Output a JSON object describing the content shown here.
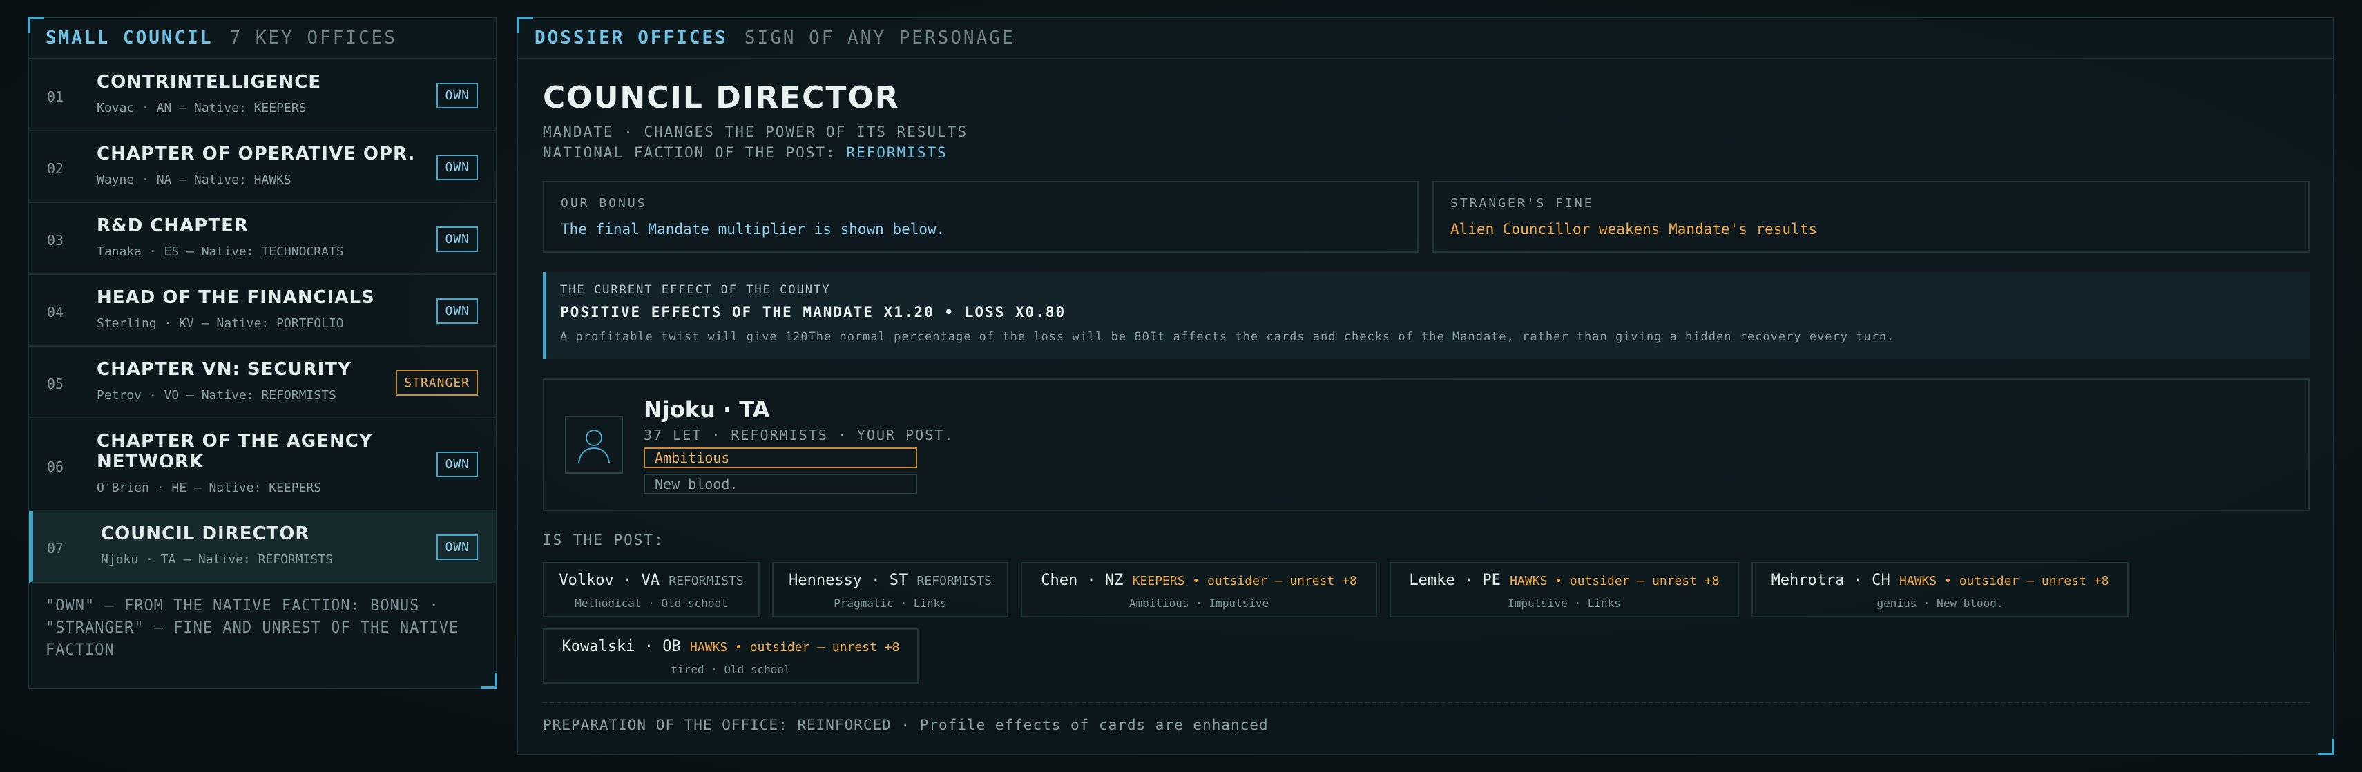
{
  "left_panel": {
    "header_title": "SMALL COUNCIL",
    "header_sub": "7 KEY OFFICES",
    "items": [
      {
        "num": "01",
        "title": "CONTRINTELLIGENCE",
        "sub": "Kovac · AN — Native: KEEPERS",
        "badge": "OWN"
      },
      {
        "num": "02",
        "title": "CHAPTER OF OPERATIVE OPR.",
        "sub": "Wayne · NA — Native: HAWKS",
        "badge": "OWN"
      },
      {
        "num": "03",
        "title": "R&D CHAPTER",
        "sub": "Tanaka · ES — Native: TECHNOCRATS",
        "badge": "OWN"
      },
      {
        "num": "04",
        "title": "HEAD OF THE FINANCIALS",
        "sub": "Sterling · KV — Native: PORTFOLIO",
        "badge": "OWN"
      },
      {
        "num": "05",
        "title": "CHAPTER VN: SECURITY",
        "sub": "Petrov · VO — Native: REFORMISTS",
        "badge": "STRANGER"
      },
      {
        "num": "06",
        "title": "CHAPTER OF THE AGENCY NETWORK",
        "sub": "O'Brien · HE — Native: KEEPERS",
        "badge": "OWN"
      },
      {
        "num": "07",
        "title": "COUNCIL DIRECTOR",
        "sub": "Njoku · TA — Native: REFORMISTS",
        "badge": "OWN"
      }
    ],
    "footnote": "\"OWN\" — FROM THE NATIVE FACTION: BONUS · \"STRANGER\" — FINE AND UNREST OF THE NATIVE FACTION"
  },
  "right_panel": {
    "header_title": "DOSSIER OFFICES",
    "header_sub": "SIGN OF ANY PERSONAGE",
    "office_title": "COUNCIL DIRECTOR",
    "mandate_line": "MANDATE · CHANGES THE POWER OF ITS RESULTS",
    "faction_label": "NATIONAL FACTION OF THE POST:",
    "faction_value": "REFORMISTS",
    "bonus_label": "OUR BONUS",
    "bonus_text": "The final Mandate multiplier is shown below.",
    "fine_label": "STRANGER'S FINE",
    "fine_text": "Alien Councillor weakens Mandate's results",
    "effect_label": "THE CURRENT EFFECT OF THE COUNTY",
    "effect_head": "POSITIVE EFFECTS OF THE MANDATE X1.20 • LOSS X0.80",
    "effect_body": "A profitable twist will give 120The normal percentage of the loss will be 80It affects the cards and checks of the Mandate, rather than giving a hidden recovery every turn.",
    "person": {
      "name": "Njoku · TA",
      "meta": "37 LET · REFORMISTS · YOUR POST.",
      "trait1": "Ambitious",
      "trait2": "New blood."
    },
    "is_post_label": "IS THE POST:",
    "candidates": [
      {
        "name": "Volkov · VA",
        "faction": "REFORMISTS",
        "outsider": false,
        "traits": "Methodical · Old school"
      },
      {
        "name": "Hennessy · ST",
        "faction": "REFORMISTS",
        "outsider": false,
        "traits": "Pragmatic · Links"
      },
      {
        "name": "Chen · NZ",
        "faction": "KEEPERS • outsider — unrest +8",
        "outsider": true,
        "traits": "Ambitious · Impulsive"
      },
      {
        "name": "Lemke · PE",
        "faction": "HAWKS • outsider — unrest +8",
        "outsider": true,
        "traits": "Impulsive · Links"
      },
      {
        "name": "Mehrotra · CH",
        "faction": "HAWKS • outsider — unrest +8",
        "outsider": true,
        "traits": "genius · New blood."
      },
      {
        "name": "Kowalski · OB",
        "faction": "HAWKS • outsider — unrest +8",
        "outsider": true,
        "traits": "tired · Old school"
      }
    ],
    "preparation": "PREPARATION OF THE OFFICE: REINFORCED · Profile effects of cards are enhanced"
  }
}
